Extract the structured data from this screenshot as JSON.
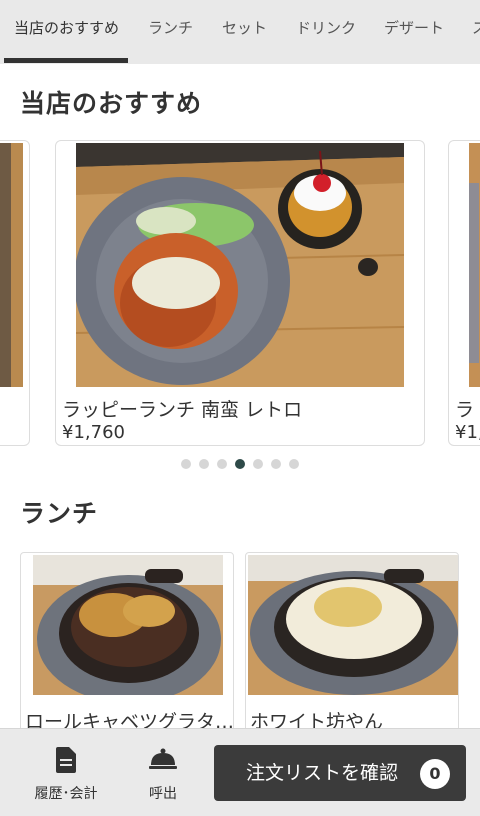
{
  "tabs": [
    {
      "label": "当店のおすすめ",
      "active": true
    },
    {
      "label": "ランチ"
    },
    {
      "label": "セット"
    },
    {
      "label": "ドリンク"
    },
    {
      "label": "デザート"
    },
    {
      "label": "ス"
    }
  ],
  "sections": {
    "recommend_title": "当店のおすすめ",
    "lunch_title": "ランチ"
  },
  "featured": {
    "name": "ラッピーランチ 南蛮 レトロ",
    "price": "¥1,760",
    "next_peek_name": "ラ",
    "next_peek_price": "¥1,"
  },
  "carousel": {
    "dot_count": 7,
    "active_index": 3
  },
  "lunch_items": [
    {
      "name": "ロールキャベツグラタ…"
    },
    {
      "name": "ホワイト坊やん"
    }
  ],
  "bottom_bar": {
    "history_label": "履歴･会計",
    "call_label": "呼出",
    "confirm_label": "注文リストを確認",
    "cart_count": "0"
  },
  "colors": {
    "tab_bar_bg": "#e9e9e9",
    "primary_button": "#3b3b3b",
    "dot_active": "#2e4a48"
  }
}
